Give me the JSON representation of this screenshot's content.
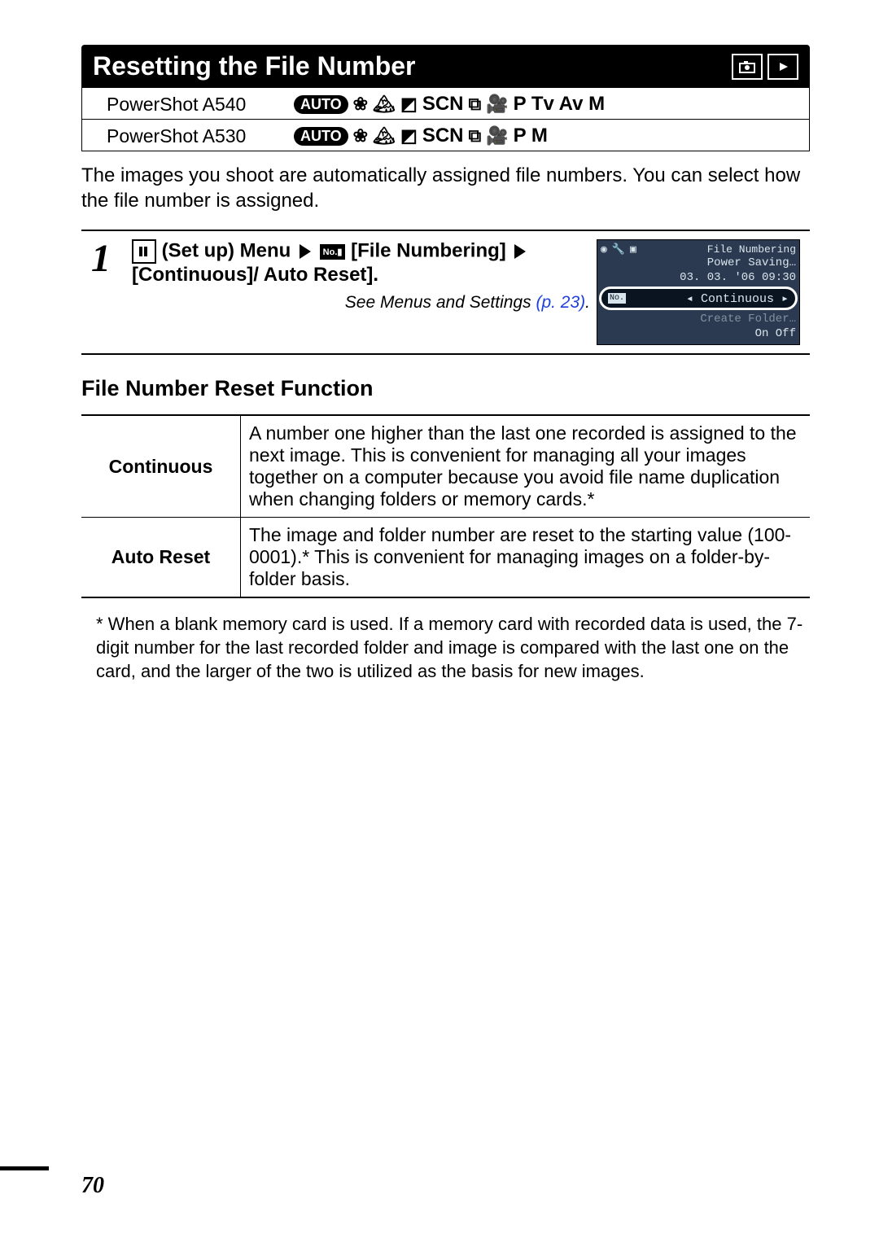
{
  "title": "Resetting the File Number",
  "title_icons": [
    "camera",
    "play"
  ],
  "models": [
    {
      "name": "PowerShot A540",
      "modes_tail": "P Tv Av M"
    },
    {
      "name": "PowerShot A530",
      "modes_tail": "P M"
    }
  ],
  "mode_common": {
    "auto": "AUTO",
    "scn": "SCN"
  },
  "intro": "The images you shoot are automatically assigned file numbers. You can select how the file number is assigned.",
  "step": {
    "num": "1",
    "line1a": " (Set up) Menu",
    "line1b": "[File Numbering]",
    "line1c": "[Continuous]/ Auto Reset].",
    "see_prefix": "See Menus and Settings ",
    "see_link": "(p. 23)",
    "see_suffix": "."
  },
  "lcd": {
    "title": "File Numbering",
    "rows": [
      [
        "",
        "Power Saving…"
      ],
      [
        "",
        "03. 03. '06 09:30"
      ]
    ],
    "selected_label": "No.",
    "selected_value": "Continuous",
    "bottom": [
      "",
      "On  Off"
    ]
  },
  "section_head": "File Number Reset Function",
  "table": [
    {
      "label": "Continuous",
      "desc": "A number one higher than the last one recorded is assigned to the next image. This is convenient for managing all your images together on a computer because you avoid file name duplication when changing folders or memory cards.*"
    },
    {
      "label": "Auto Reset",
      "desc": "The image and folder number are reset to the starting value (100-0001).* This is convenient for managing images on a folder-by-folder basis."
    }
  ],
  "footnote": "* When a blank memory card is used. If a memory card with recorded data is used, the 7-digit number for the last recorded folder and image is compared with the last one on the card, and the larger of the two is utilized as the basis for new images.",
  "page_number": "70"
}
